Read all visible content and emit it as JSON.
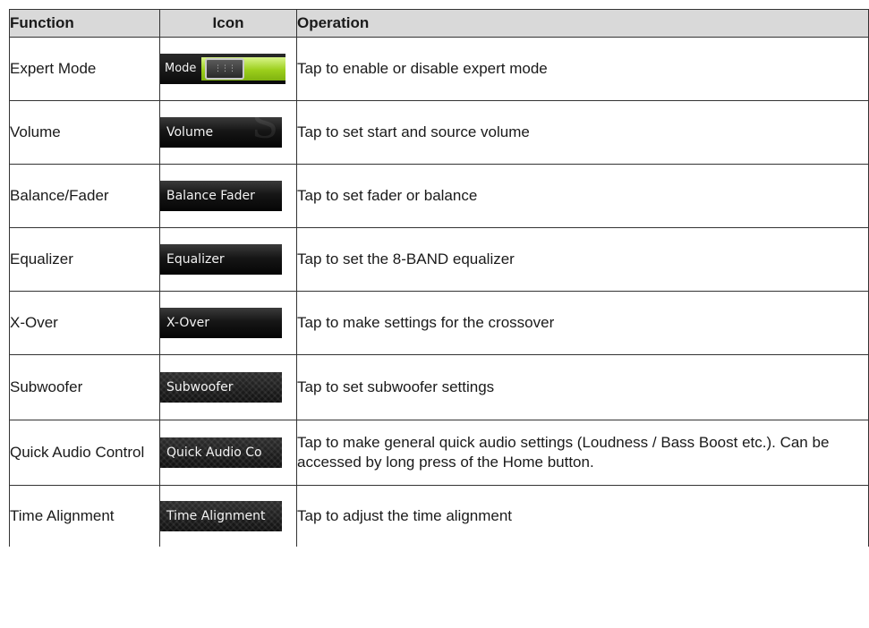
{
  "headers": {
    "function": "Function",
    "icon": "Icon",
    "operation": "Operation"
  },
  "rows": [
    {
      "function": "Expert Mode",
      "icon_label": "Mode",
      "operation": "Tap to enable or disable expert mode"
    },
    {
      "function": "Volume",
      "icon_label": "Volume",
      "operation": "Tap to set start and source volume"
    },
    {
      "function": "Balance/Fader",
      "icon_label": "Balance Fader",
      "operation": "Tap to set fader or balance"
    },
    {
      "function": "Equalizer",
      "icon_label": "Equalizer",
      "operation": "Tap to set the 8-BAND equalizer"
    },
    {
      "function": "X-Over",
      "icon_label": "X-Over",
      "operation": "Tap to make settings for the crossover"
    },
    {
      "function": "Subwoofer",
      "icon_label": "Subwoofer",
      "operation": "Tap to set subwoofer settings"
    },
    {
      "function": "Quick Audio Control",
      "icon_label": "Quick Audio Co",
      "operation": "Tap to make general quick audio settings (Loudness / Bass Boost etc.). Can be accessed by long press of the Home button."
    },
    {
      "function": "Time Alignment",
      "icon_label": "Time Alignment",
      "operation": "Tap to adjust the time alignment"
    }
  ],
  "colors": {
    "header_bg": "#d9d9d9",
    "toggle_on": "#9ccf1c",
    "icon_bg": "#111111"
  }
}
